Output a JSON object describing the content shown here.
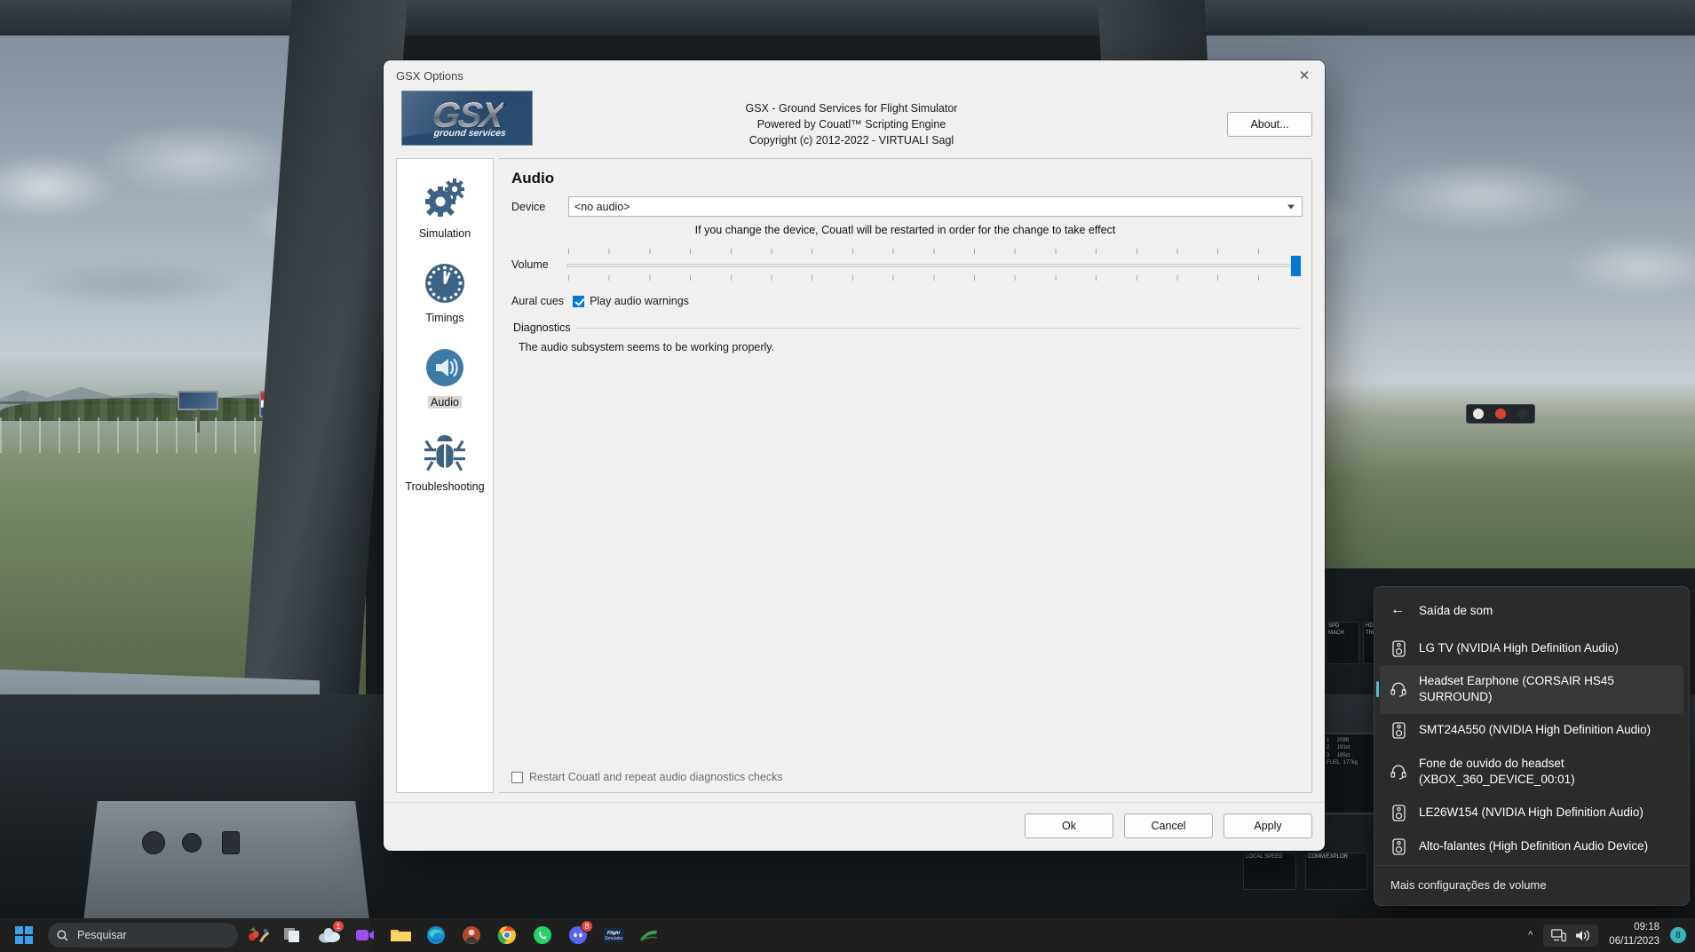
{
  "window": {
    "title": "GSX Options",
    "close_icon": "close-icon",
    "logo_text": "GSX",
    "logo_subtitle": "ground services",
    "header_line1": "GSX - Ground Services for Flight Simulator",
    "header_line2": "Powered by Couatl™ Scripting Engine",
    "header_line3": "Copyright (c) 2012-2022 - VIRTUALI Sagl",
    "about_label": "About..."
  },
  "nav": {
    "items": [
      {
        "label": "Simulation",
        "icon": "gears-icon",
        "active": false
      },
      {
        "label": "Timings",
        "icon": "clock-icon",
        "active": false
      },
      {
        "label": "Audio",
        "icon": "speaker-icon",
        "active": true
      },
      {
        "label": "Troubleshooting",
        "icon": "bug-icon",
        "active": false
      }
    ]
  },
  "audio_panel": {
    "section_title": "Audio",
    "device_label": "Device",
    "device_value": "<no audio>",
    "device_options": [
      "<no audio>"
    ],
    "restart_hint": "If you change the device, Couatl will be restarted in order for the change to take effect",
    "volume_label": "Volume",
    "volume_value": 100,
    "aural_cues_label": "Aural cues",
    "play_audio_warnings_label": "Play audio warnings",
    "play_audio_warnings_checked": true,
    "diagnostics_legend": "Diagnostics",
    "diagnostics_text": "The audio subsystem seems to be working properly.",
    "restart_checkbox_label": "Restart Couatl and repeat audio diagnostics checks",
    "restart_checkbox_checked": false
  },
  "footer": {
    "ok_label": "Ok",
    "cancel_label": "Cancel",
    "apply_label": "Apply"
  },
  "audio_flyout": {
    "back_icon": "back-arrow-icon",
    "title": "Saída de som",
    "footer_label": "Mais configurações de volume",
    "devices": [
      {
        "label": "LG TV (NVIDIA High Definition Audio)",
        "icon": "speaker-device-icon",
        "selected": false
      },
      {
        "label": "Headset Earphone (CORSAIR HS45 SURROUND)",
        "icon": "headset-icon",
        "selected": true
      },
      {
        "label": "SMT24A550 (NVIDIA High Definition Audio)",
        "icon": "speaker-device-icon",
        "selected": false
      },
      {
        "label": "Fone de ouvido do headset (XBOX_360_DEVICE_00:01)",
        "icon": "headset-icon",
        "selected": false
      },
      {
        "label": "LE26W154 (NVIDIA High Definition Audio)",
        "icon": "speaker-device-icon",
        "selected": false
      },
      {
        "label": "Alto-falantes (High Definition Audio Device)",
        "icon": "speaker-device-icon",
        "selected": false
      }
    ]
  },
  "taskbar": {
    "start_label": "Start",
    "search_placeholder": "Pesquisar",
    "search_icon": "search-icon",
    "apps": [
      {
        "name": "game-app-icon",
        "badge": ""
      },
      {
        "name": "task-view-icon",
        "badge": ""
      },
      {
        "name": "onedrive-icon",
        "badge": "1"
      },
      {
        "name": "zoom-icon",
        "badge": ""
      },
      {
        "name": "file-explorer-icon",
        "badge": ""
      },
      {
        "name": "edge-icon",
        "badge": ""
      },
      {
        "name": "photo-app-icon",
        "badge": ""
      },
      {
        "name": "chrome-icon",
        "badge": ""
      },
      {
        "name": "whatsapp-icon",
        "badge": ""
      },
      {
        "name": "discord-icon",
        "badge": "8"
      },
      {
        "name": "flight-simulator-icon",
        "badge": ""
      },
      {
        "name": "addon-manager-icon",
        "badge": ""
      }
    ],
    "tray": {
      "chevron_icon": "chevron-up-icon",
      "network_icon": "network-icon",
      "volume_icon": "volume-icon",
      "time": "09:18",
      "date": "06/11/2023",
      "notification_count": "8"
    }
  },
  "colors": {
    "accent": "#0078d4",
    "selection_bar": "#4cc2c4",
    "gsx_blue": "#2a4d71",
    "window_bg": "#f0f0f0",
    "flyout_bg": "#2b2b2b"
  }
}
